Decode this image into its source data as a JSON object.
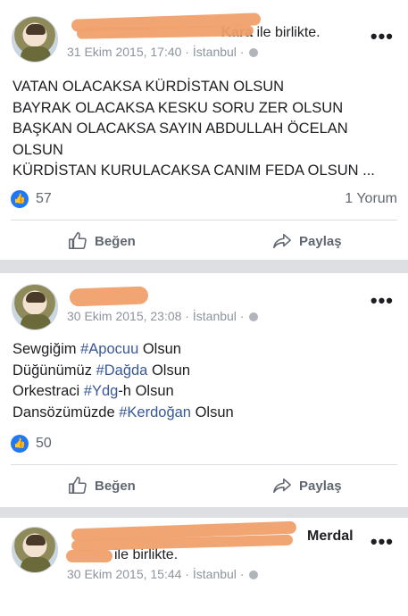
{
  "posts": [
    {
      "names_suffix": "Kara",
      "with_text": "ile birlikte.",
      "date": "31 Ekim 2015, 17:40",
      "location": "İstanbul",
      "lines": [
        "VATAN OLACAKSA KÜRDİSTAN OLSUN",
        "BAYRAK OLACAKSA KESKU SORU ZER OLSUN",
        "BAŞKAN OLACAKSA SAYIN ABDULLAH ÖCELAN",
        "OLSUN",
        "KÜRDİSTAN KURULACAKSA CANIM FEDA OLSUN ..."
      ],
      "likes": "57",
      "comments": "1 Yorum",
      "like_label": "Beğen",
      "share_label": "Paylaş"
    },
    {
      "date": "30 Ekim 2015, 23:08",
      "location": "İstanbul",
      "lines": [
        {
          "pre": "Sewgiğim ",
          "tag": "#Apocuu",
          "post": " Olsun"
        },
        {
          "pre": "Düğünümüz ",
          "tag": "#Dağda",
          "post": " Olsun"
        },
        {
          "pre": "Orkestraci ",
          "tag": "#Ydg",
          "post": "-h Olsun"
        },
        {
          "pre": "Dansözümüzde ",
          "tag": "#Kerdoğan",
          "post": " Olsun"
        }
      ],
      "likes": "50",
      "like_label": "Beğen",
      "share_label": "Paylaş"
    },
    {
      "names_suffix": "Merdal",
      "with_text": "ile birlikte.",
      "date": "30 Ekim 2015, 15:44",
      "location": "İstanbul"
    }
  ],
  "more_glyph": "•••",
  "colors": {
    "like_blue": "#2078f4",
    "hashtag": "#385898",
    "redaction": "#f0a06a"
  }
}
